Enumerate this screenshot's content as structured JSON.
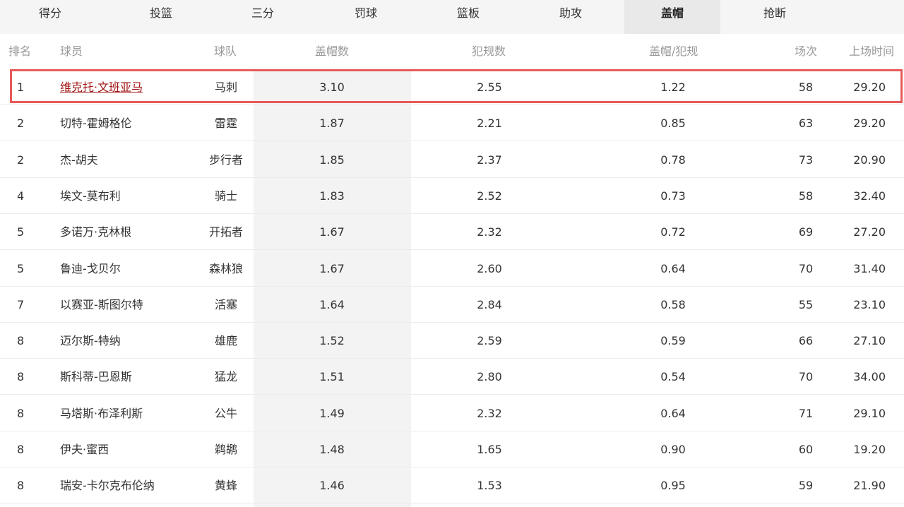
{
  "tabs": [
    {
      "label": "得分",
      "active": false
    },
    {
      "label": "投篮",
      "active": false
    },
    {
      "label": "三分",
      "active": false
    },
    {
      "label": "罚球",
      "active": false
    },
    {
      "label": "篮板",
      "active": false
    },
    {
      "label": "助攻",
      "active": false
    },
    {
      "label": "盖帽",
      "active": true
    },
    {
      "label": "抢断",
      "active": false
    }
  ],
  "columns": {
    "rank": "排名",
    "player": "球员",
    "team": "球队",
    "blocks": "盖帽数",
    "fouls": "犯规数",
    "ratio": "盖帽/犯规",
    "games": "场次",
    "minutes": "上场时间"
  },
  "rows": [
    {
      "rank": "1",
      "player": "维克托·文班亚马",
      "team": "马刺",
      "blocks": "3.10",
      "fouls": "2.55",
      "ratio": "1.22",
      "games": "58",
      "minutes": "29.20",
      "linked": true
    },
    {
      "rank": "2",
      "player": "切特-霍姆格伦",
      "team": "雷霆",
      "blocks": "1.87",
      "fouls": "2.21",
      "ratio": "0.85",
      "games": "63",
      "minutes": "29.20"
    },
    {
      "rank": "2",
      "player": "杰-胡夫",
      "team": "步行者",
      "blocks": "1.85",
      "fouls": "2.37",
      "ratio": "0.78",
      "games": "73",
      "minutes": "20.90"
    },
    {
      "rank": "4",
      "player": "埃文-莫布利",
      "team": "骑士",
      "blocks": "1.83",
      "fouls": "2.52",
      "ratio": "0.73",
      "games": "58",
      "minutes": "32.40"
    },
    {
      "rank": "5",
      "player": "多诺万·克林根",
      "team": "开拓者",
      "blocks": "1.67",
      "fouls": "2.32",
      "ratio": "0.72",
      "games": "69",
      "minutes": "27.20"
    },
    {
      "rank": "5",
      "player": "鲁迪-戈贝尔",
      "team": "森林狼",
      "blocks": "1.67",
      "fouls": "2.60",
      "ratio": "0.64",
      "games": "70",
      "minutes": "31.40"
    },
    {
      "rank": "7",
      "player": "以赛亚-斯图尔特",
      "team": "活塞",
      "blocks": "1.64",
      "fouls": "2.84",
      "ratio": "0.58",
      "games": "55",
      "minutes": "23.10"
    },
    {
      "rank": "8",
      "player": "迈尔斯-特纳",
      "team": "雄鹿",
      "blocks": "1.52",
      "fouls": "2.59",
      "ratio": "0.59",
      "games": "66",
      "minutes": "27.10"
    },
    {
      "rank": "8",
      "player": "斯科蒂-巴恩斯",
      "team": "猛龙",
      "blocks": "1.51",
      "fouls": "2.80",
      "ratio": "0.54",
      "games": "70",
      "minutes": "34.00"
    },
    {
      "rank": "8",
      "player": "马塔斯·布泽利斯",
      "team": "公牛",
      "blocks": "1.49",
      "fouls": "2.32",
      "ratio": "0.64",
      "games": "71",
      "minutes": "29.10"
    },
    {
      "rank": "8",
      "player": "伊夫·蜜西",
      "team": "鹈鹕",
      "blocks": "1.48",
      "fouls": "1.65",
      "ratio": "0.90",
      "games": "60",
      "minutes": "19.20"
    },
    {
      "rank": "8",
      "player": "瑞安-卡尔克布伦纳",
      "team": "黄蜂",
      "blocks": "1.46",
      "fouls": "1.53",
      "ratio": "0.95",
      "games": "59",
      "minutes": "21.90"
    }
  ],
  "colors": {
    "highlight_border": "#e85a5a",
    "link": "#a31515",
    "active_tab_bg": "#e9e9e9",
    "shaded_column": "#f3f3f3"
  }
}
